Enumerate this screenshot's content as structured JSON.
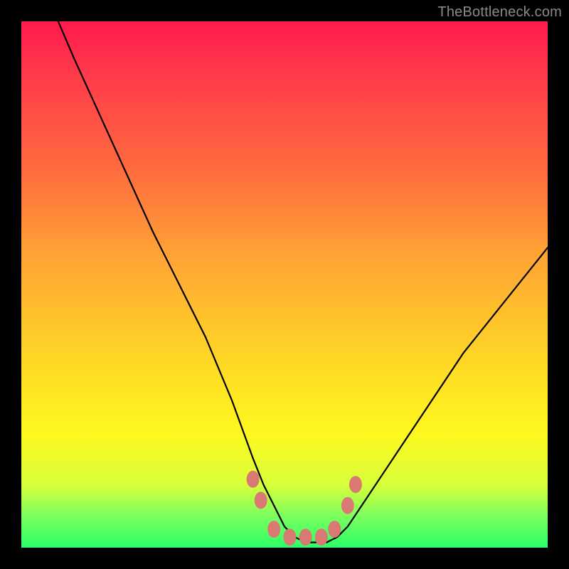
{
  "watermark": "TheBottleneck.com",
  "chart_data": {
    "type": "line",
    "title": "",
    "xlabel": "",
    "ylabel": "",
    "xlim": [
      0,
      100
    ],
    "ylim": [
      0,
      100
    ],
    "grid": false,
    "legend": false,
    "series": [
      {
        "name": "curve",
        "color": "#000000",
        "x": [
          7,
          10,
          15,
          20,
          25,
          30,
          35,
          40,
          44,
          46,
          48,
          50,
          52,
          54,
          56,
          58,
          60,
          62,
          64,
          68,
          72,
          76,
          80,
          84,
          88,
          92,
          96,
          100
        ],
        "y": [
          100,
          93,
          82,
          71,
          60,
          50,
          40,
          28,
          17,
          12,
          8,
          4,
          2,
          1,
          1,
          1,
          2,
          4,
          7,
          13,
          19,
          25,
          31,
          37,
          42,
          47,
          52,
          57
        ]
      }
    ],
    "markers": {
      "name": "dots",
      "color": "#d97a72",
      "x": [
        44,
        45.5,
        48,
        51,
        54,
        57,
        59.5,
        62,
        63.5
      ],
      "y": [
        13,
        9,
        3.5,
        2,
        2,
        2,
        3.5,
        8,
        12
      ]
    },
    "background_gradient": {
      "top": "#ff1a4d",
      "mid": "#fff81f",
      "bottom": "#2bff66"
    }
  }
}
